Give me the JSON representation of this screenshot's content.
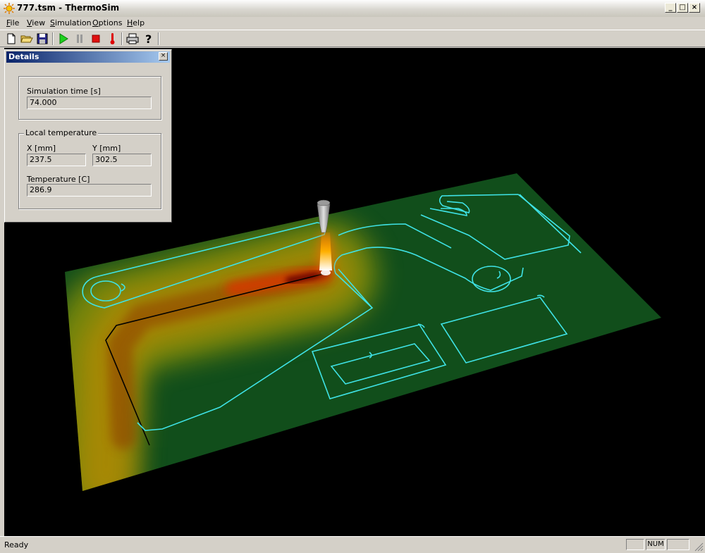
{
  "window": {
    "title": "777.tsm - ThermoSim"
  },
  "menu": [
    {
      "u": "F",
      "rest": "ile"
    },
    {
      "u": "V",
      "rest": "iew"
    },
    {
      "u": "S",
      "rest": "imulation"
    },
    {
      "u": "O",
      "rest": "ptions"
    },
    {
      "u": "H",
      "rest": "elp"
    }
  ],
  "toolbar": [
    "new-file-icon",
    "open-folder-icon",
    "save-icon",
    "play-icon",
    "pause-icon",
    "stop-icon",
    "thermometer-icon",
    "print-icon",
    "help-icon"
  ],
  "details": {
    "title": "Details",
    "sim_time_label": "Simulation time [s]",
    "sim_time_value": "74.000",
    "local_temp_group": "Local temperature",
    "x_label": "X [mm]",
    "x_value": "237.5",
    "y_label": "Y [mm]",
    "y_value": "302.5",
    "temp_label": "Temperature [C]",
    "temp_value": "286.9"
  },
  "status": {
    "text": "Ready",
    "num": "NUM"
  },
  "colors": {
    "plate": "#114e1b",
    "cut_path": "#3fe3e6",
    "hot": "#ff7a00",
    "viewport_bg": "#000000"
  }
}
